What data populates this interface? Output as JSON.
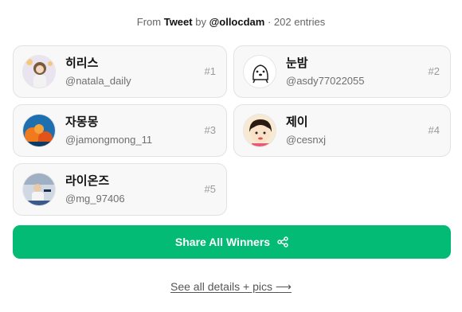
{
  "source": {
    "prefix": "From",
    "kind": "Tweet",
    "by": "by",
    "author": "@ollocdam",
    "entries": "· 202 entries"
  },
  "winners": [
    {
      "name": "히리스",
      "handle": "@natala_daily",
      "rank": "#1"
    },
    {
      "name": "눈밤",
      "handle": "@asdy77022055",
      "rank": "#2"
    },
    {
      "name": "자몽몽",
      "handle": "@jamongmong_11",
      "rank": "#3"
    },
    {
      "name": "제이",
      "handle": "@cesnxj",
      "rank": "#4"
    },
    {
      "name": "라이온즈",
      "handle": "@mg_97406",
      "rank": "#5"
    }
  ],
  "share_button": {
    "label": "Share All Winners",
    "icon": "share-icon"
  },
  "details_link": {
    "label": "See all details + pics ⟶"
  },
  "colors": {
    "accent": "#04bb75",
    "card_bg": "#f8f8f8"
  }
}
